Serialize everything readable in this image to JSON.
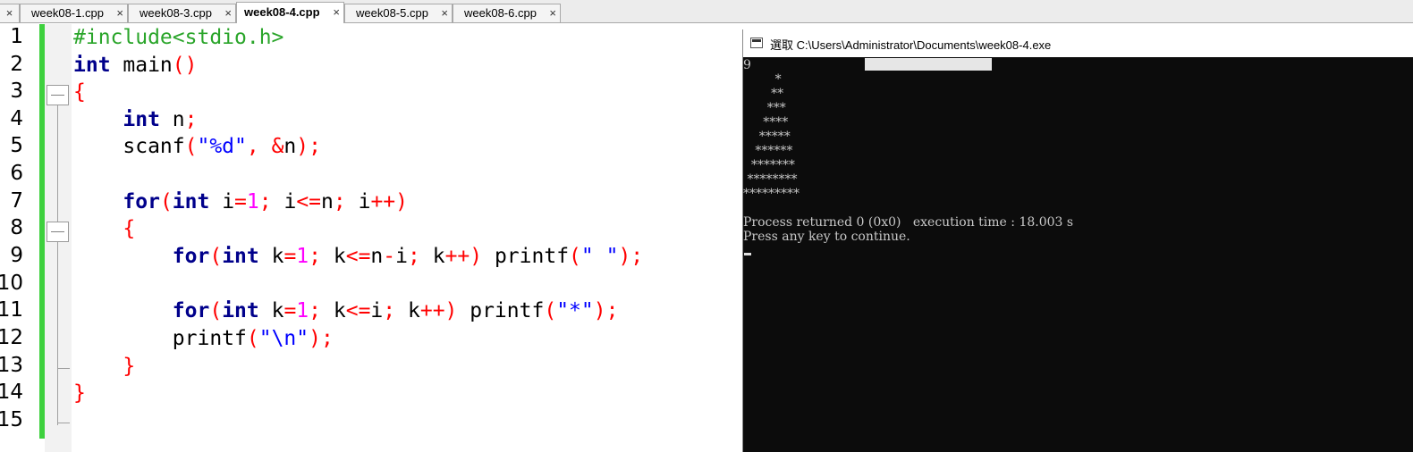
{
  "tabs": [
    {
      "label": "week08-1.cpp",
      "close": "×",
      "active": false
    },
    {
      "label": "week08-3.cpp",
      "close": "×",
      "active": false
    },
    {
      "label": "week08-4.cpp",
      "close": "×",
      "active": true
    },
    {
      "label": "week08-5.cpp",
      "close": "×",
      "active": false
    },
    {
      "label": "week08-6.cpp",
      "close": "×",
      "active": false
    }
  ],
  "tab_stub_close": "×",
  "editor": {
    "line_numbers": [
      "1",
      "2",
      "3",
      "4",
      "5",
      "6",
      "7",
      "8",
      "9",
      "10",
      "11",
      "12",
      "13",
      "14",
      "15"
    ],
    "lines": [
      [
        {
          "t": "#include<stdio.h>",
          "c": "pp"
        }
      ],
      [
        {
          "t": "int",
          "c": "kw"
        },
        {
          "t": " main",
          "c": ""
        },
        {
          "t": "()",
          "c": "op"
        }
      ],
      [
        {
          "t": "{",
          "c": "op"
        }
      ],
      [
        {
          "t": "    ",
          "c": ""
        },
        {
          "t": "int",
          "c": "kw"
        },
        {
          "t": " n",
          "c": ""
        },
        {
          "t": ";",
          "c": "op"
        }
      ],
      [
        {
          "t": "    scanf",
          "c": ""
        },
        {
          "t": "(",
          "c": "op"
        },
        {
          "t": "\"%d\"",
          "c": "str"
        },
        {
          "t": ", &",
          "c": "op"
        },
        {
          "t": "n",
          "c": ""
        },
        {
          "t": ");",
          "c": "op"
        }
      ],
      [],
      [
        {
          "t": "    ",
          "c": ""
        },
        {
          "t": "for",
          "c": "kw"
        },
        {
          "t": "(",
          "c": "op"
        },
        {
          "t": "int",
          "c": "kw"
        },
        {
          "t": " i",
          "c": ""
        },
        {
          "t": "=",
          "c": "op"
        },
        {
          "t": "1",
          "c": "num"
        },
        {
          "t": ";",
          "c": "op"
        },
        {
          "t": " i",
          "c": ""
        },
        {
          "t": "<=",
          "c": "op"
        },
        {
          "t": "n",
          "c": ""
        },
        {
          "t": ";",
          "c": "op"
        },
        {
          "t": " i",
          "c": ""
        },
        {
          "t": "++)",
          "c": "op"
        }
      ],
      [
        {
          "t": "    ",
          "c": ""
        },
        {
          "t": "{",
          "c": "op"
        }
      ],
      [
        {
          "t": "        ",
          "c": ""
        },
        {
          "t": "for",
          "c": "kw"
        },
        {
          "t": "(",
          "c": "op"
        },
        {
          "t": "int",
          "c": "kw"
        },
        {
          "t": " k",
          "c": ""
        },
        {
          "t": "=",
          "c": "op"
        },
        {
          "t": "1",
          "c": "num"
        },
        {
          "t": ";",
          "c": "op"
        },
        {
          "t": " k",
          "c": ""
        },
        {
          "t": "<=",
          "c": "op"
        },
        {
          "t": "n",
          "c": ""
        },
        {
          "t": "-",
          "c": "op"
        },
        {
          "t": "i",
          "c": ""
        },
        {
          "t": ";",
          "c": "op"
        },
        {
          "t": " k",
          "c": ""
        },
        {
          "t": "++)",
          "c": "op"
        },
        {
          "t": " printf",
          "c": ""
        },
        {
          "t": "(",
          "c": "op"
        },
        {
          "t": "\" \"",
          "c": "str"
        },
        {
          "t": ");",
          "c": "op"
        }
      ],
      [],
      [
        {
          "t": "        ",
          "c": ""
        },
        {
          "t": "for",
          "c": "kw"
        },
        {
          "t": "(",
          "c": "op"
        },
        {
          "t": "int",
          "c": "kw"
        },
        {
          "t": " k",
          "c": ""
        },
        {
          "t": "=",
          "c": "op"
        },
        {
          "t": "1",
          "c": "num"
        },
        {
          "t": ";",
          "c": "op"
        },
        {
          "t": " k",
          "c": ""
        },
        {
          "t": "<=",
          "c": "op"
        },
        {
          "t": "i",
          "c": ""
        },
        {
          "t": ";",
          "c": "op"
        },
        {
          "t": " k",
          "c": ""
        },
        {
          "t": "++)",
          "c": "op"
        },
        {
          "t": " printf",
          "c": ""
        },
        {
          "t": "(",
          "c": "op"
        },
        {
          "t": "\"*\"",
          "c": "str"
        },
        {
          "t": ");",
          "c": "op"
        }
      ],
      [
        {
          "t": "        printf",
          "c": ""
        },
        {
          "t": "(",
          "c": "op"
        },
        {
          "t": "\"\\n\"",
          "c": "str"
        },
        {
          "t": ");",
          "c": "op"
        }
      ],
      [
        {
          "t": "    ",
          "c": ""
        },
        {
          "t": "}",
          "c": "op"
        }
      ],
      [
        {
          "t": "}",
          "c": "op"
        }
      ],
      []
    ]
  },
  "console": {
    "title": "選取 C:\\Users\\Administrator\\Documents\\week08-4.exe",
    "lines": [
      "9",
      "        *",
      "       **",
      "      ***",
      "     ****",
      "    *****",
      "   ******",
      "  *******",
      " ********",
      "*********",
      "",
      "Process returned 0 (0x0)   execution time : 18.003 s",
      "Press any key to continue."
    ]
  }
}
